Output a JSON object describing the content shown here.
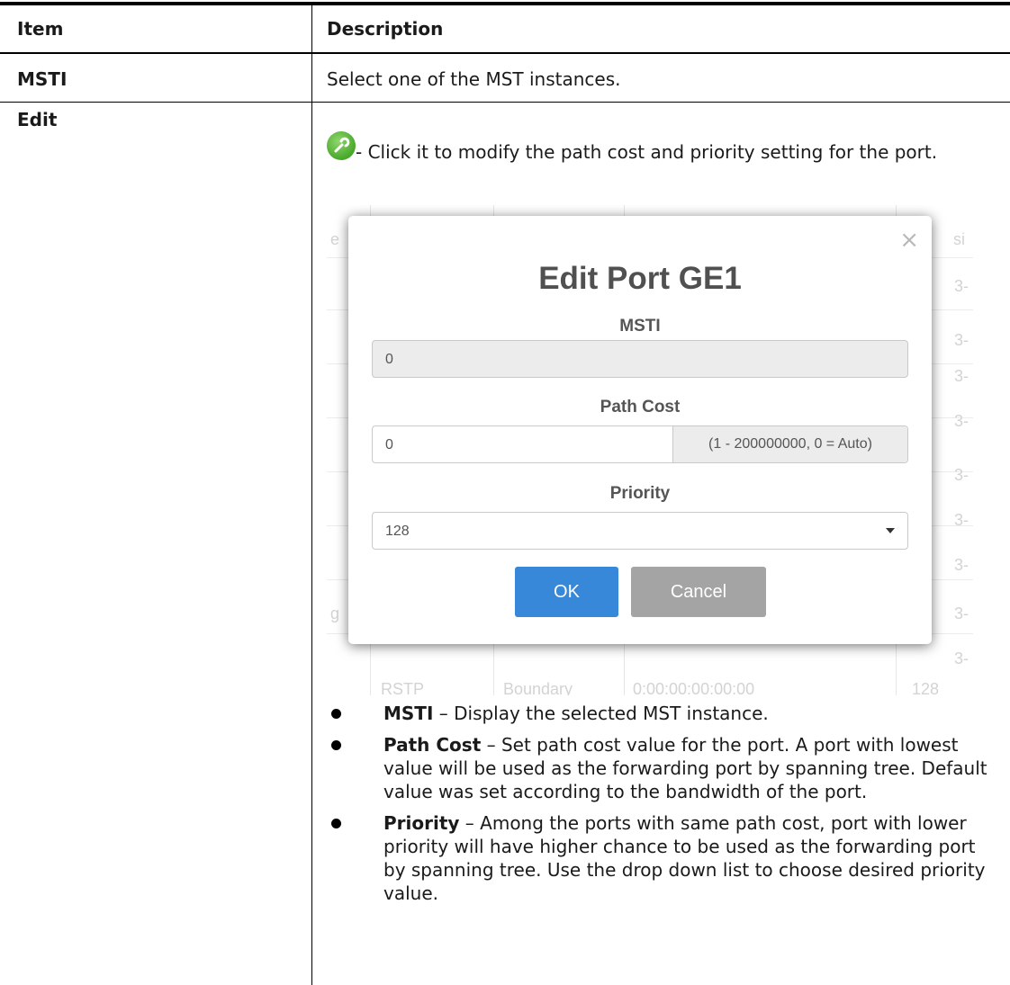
{
  "table": {
    "header": {
      "item": "Item",
      "description": "Description"
    },
    "rows": [
      {
        "item": "MSTI",
        "description": "Select one of the MST instances."
      },
      {
        "item": "Edit",
        "description": "- Click it to modify the path cost and priority setting for the port."
      }
    ]
  },
  "icon": {
    "name": "wrench-icon",
    "color": "#48a82a"
  },
  "dialog": {
    "title": "Edit Port GE1",
    "close_glyph": "×",
    "msti_label": "MSTI",
    "msti_value": "0",
    "path_cost_label": "Path Cost",
    "path_cost_value": "0",
    "path_cost_hint": "(1 - 200000000, 0 = Auto)",
    "priority_label": "Priority",
    "priority_value": "128",
    "ok_label": "OK",
    "cancel_label": "Cancel",
    "ok_color": "#3788d8",
    "cancel_color": "#a4a4a4"
  },
  "background_fragments": {
    "left": [
      "e",
      "g"
    ],
    "right": [
      "si",
      "3-",
      "3-",
      "3-",
      "3-",
      "3-",
      "3-",
      "3-",
      "3-",
      "3-"
    ],
    "bottom": [
      "RSTP",
      "Boundary",
      "0:00:00:00:00:00",
      "128"
    ]
  },
  "bullets": [
    {
      "term": "MSTI",
      "text": " – Display the selected MST instance."
    },
    {
      "term": "Path Cost",
      "text": " – Set path cost value for the port. A port with lowest value will be used as the forwarding port by spanning tree. Default value was set according to the bandwidth of the port."
    },
    {
      "term": "Priority",
      "text": " – Among the ports with same path cost, port with lower priority will have higher chance to be used as the forwarding port by spanning tree. Use the drop down list to choose desired priority value."
    }
  ]
}
